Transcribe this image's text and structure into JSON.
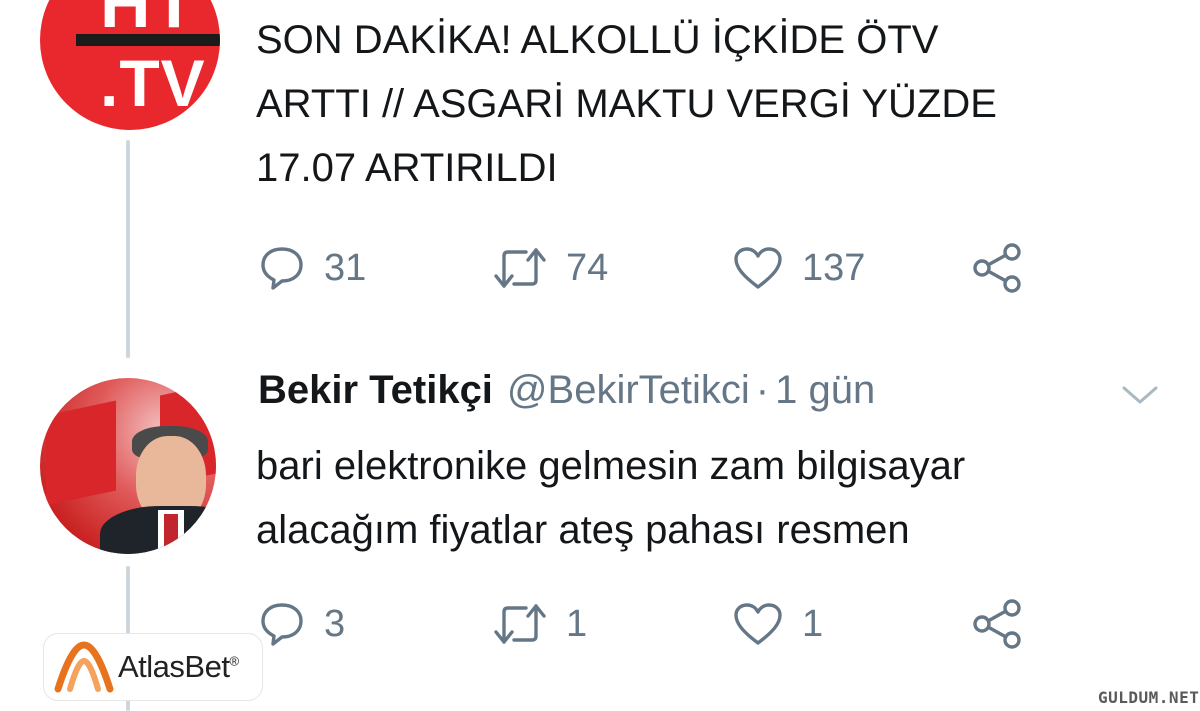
{
  "tweet1": {
    "avatar_text_top": "HT",
    "avatar_text_bottom": ".TV",
    "text_lines": [
      "SON DAKİKA! ALKOLLÜ İÇKİDE ÖTV",
      "ARTTI // ASGARİ MAKTU VERGİ YÜZDE",
      "17.07 ARTIRILDI"
    ],
    "replies": "31",
    "retweets": "74",
    "likes": "137"
  },
  "tweet2": {
    "name": "Bekir Tetikçi",
    "handle": "@BekirTetikci",
    "separator": "·",
    "time": "1 gün",
    "text_lines": [
      "bari elektronike gelmesin zam bilgisayar",
      "alacağım fiyatlar ateş pahası resmen"
    ],
    "replies": "3",
    "retweets": "1",
    "likes": "1"
  },
  "overlay": {
    "logo_brand": "AtlasBet",
    "logo_reg": "®",
    "watermark": "GULDUM.NET"
  },
  "colors": {
    "text": "#14171a",
    "secondary": "#657786",
    "thread_line": "#ccd6dd",
    "ht_red": "#e8282d",
    "logo_orange": "#e8731e"
  },
  "icons": [
    "reply-icon",
    "retweet-icon",
    "like-icon",
    "share-icon",
    "chevron-down-icon"
  ]
}
